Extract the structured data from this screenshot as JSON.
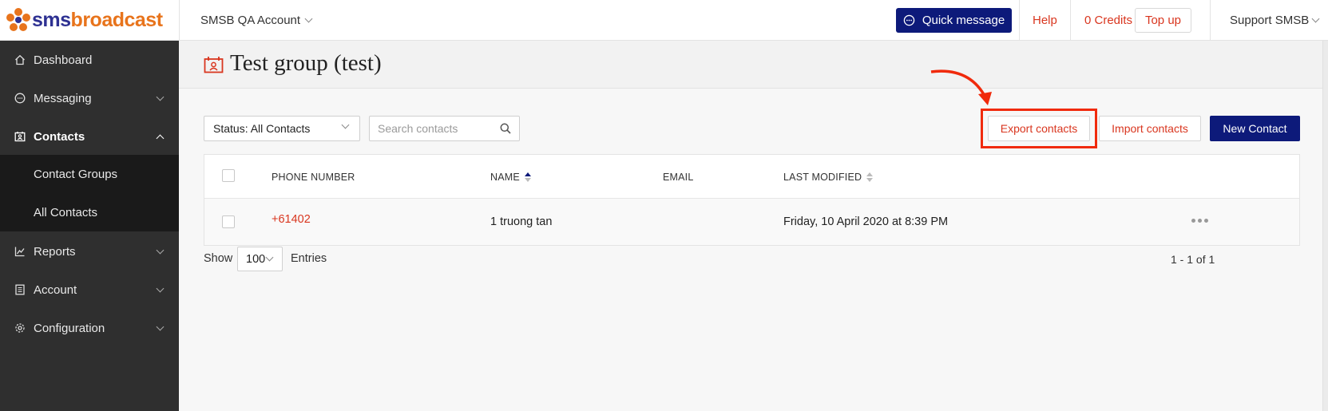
{
  "brand": {
    "name_part1": "sms",
    "name_part2": "broadcast",
    "accent": "#e8741c",
    "primary": "#2e3192"
  },
  "colors": {
    "navy": "#0d1a7a",
    "link_red": "#d9361f",
    "highlight": "#f02a0c",
    "sidebar_bg": "#2f2f2f"
  },
  "header": {
    "account": "SMSB QA Account",
    "quick_message": "Quick message",
    "help": "Help",
    "credits": "0 Credits",
    "top_up": "Top up",
    "support": "Support SMSB"
  },
  "sidebar": {
    "items": [
      {
        "label": "Dashboard",
        "icon": "home-icon"
      },
      {
        "label": "Messaging",
        "icon": "chat-icon"
      },
      {
        "label": "Contacts",
        "icon": "contacts-icon"
      },
      {
        "label": "Reports",
        "icon": "chart-icon"
      },
      {
        "label": "Account",
        "icon": "document-icon"
      },
      {
        "label": "Configuration",
        "icon": "gear-icon"
      }
    ],
    "sub_items": [
      {
        "label": "Contact Groups"
      },
      {
        "label": "All Contacts"
      }
    ]
  },
  "page": {
    "title": "Test group (test)",
    "status_filter": "Status: All Contacts",
    "search_placeholder": "Search contacts",
    "export": "Export contacts",
    "import": "Import contacts",
    "new_contact": "New Contact"
  },
  "table": {
    "columns": [
      "PHONE NUMBER",
      "NAME",
      "EMAIL",
      "LAST MODIFIED"
    ],
    "rows": [
      {
        "phone": "+61402",
        "name": "1 truong tan",
        "email": "",
        "modified": "Friday, 10 April 2020 at 8:39 PM"
      }
    ]
  },
  "footer": {
    "show": "Show",
    "entries_value": "100",
    "entries": "Entries",
    "range": "1 - 1 of 1"
  }
}
